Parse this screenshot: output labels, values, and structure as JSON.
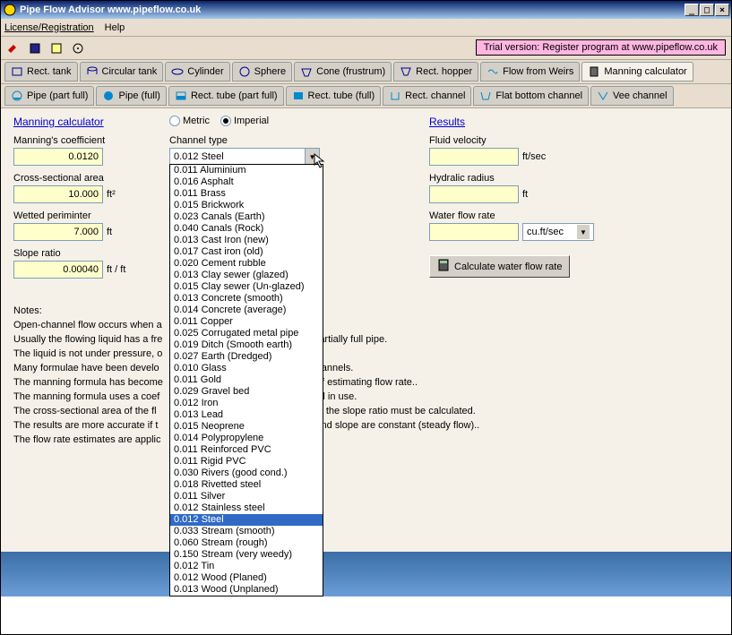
{
  "title": "Pipe Flow Advisor     www.pipeflow.co.uk",
  "menu": {
    "license": "License/Registration",
    "help": "Help"
  },
  "trial": "Trial version: Register program at www.pipeflow.co.uk",
  "tabs1": [
    {
      "label": "Rect. tank"
    },
    {
      "label": "Circular tank"
    },
    {
      "label": "Cylinder"
    },
    {
      "label": "Sphere"
    },
    {
      "label": "Cone (frustrum)"
    },
    {
      "label": "Rect. hopper"
    },
    {
      "label": "Flow from Weirs"
    },
    {
      "label": "Manning calculator"
    }
  ],
  "tabs2": [
    {
      "label": "Pipe (part full)"
    },
    {
      "label": "Pipe (full)"
    },
    {
      "label": "Rect. tube (part full)"
    },
    {
      "label": "Rect. tube (full)"
    },
    {
      "label": "Rect. channel"
    },
    {
      "label": "Flat bottom channel"
    },
    {
      "label": "Vee channel"
    }
  ],
  "manning": {
    "title": "Manning calculator",
    "coef_label": "Manning's coefficient",
    "coef_value": "0.0120",
    "area_label": "Cross-sectional area",
    "area_value": "10.000",
    "area_unit": "ft²",
    "wetted_label": "Wetted periminter",
    "wetted_value": "7.000",
    "wetted_unit": "ft",
    "slope_label": "Slope ratio",
    "slope_value": "0.00040",
    "slope_unit": "ft / ft"
  },
  "units": {
    "metric": "Metric",
    "imperial": "Imperial"
  },
  "channel": {
    "label": "Channel type",
    "selected": "0.012  Steel",
    "options": [
      "0.011  Aluminium",
      "0.016  Asphalt",
      "0.011  Brass",
      "0.015  Brickwork",
      "0.023  Canals (Earth)",
      "0.040  Canals (Rock)",
      "0.013  Cast Iron (new)",
      "0.017  Cast iron (old)",
      "0.020  Cement rubble",
      "0.013  Clay sewer (glazed)",
      "0.015  Clay sewer (Un-glazed)",
      "0.013  Concrete (smooth)",
      "0.014  Concrete (average)",
      "0.011  Copper",
      "0.025  Corrugated metal pipe",
      "0.019  Ditch (Smooth earth)",
      "0.027  Earth (Dredged)",
      "0.010  Glass",
      "0.011  Gold",
      "0.029  Gravel bed",
      "0.012  Iron",
      "0.013  Lead",
      "0.015  Neoprene",
      "0.014  Polypropylene",
      "0.011  Reinforced PVC",
      "0.011  Rigid PVC",
      "0.030  Rivers (good cond.)",
      "0.018  Rivetted steel",
      "0.011  Silver",
      "0.012  Stainless steel",
      "0.012  Steel",
      "0.033  Stream (smooth)",
      "0.060  Stream (rough)",
      "0.150  Stream (very weedy)",
      "0.012  Tin",
      "0.012  Wood (Planed)",
      "0.013  Wood (Unplaned)"
    ]
  },
  "results": {
    "title": "Results",
    "velocity_label": "Fluid velocity",
    "velocity_unit": "ft/sec",
    "radius_label": "Hydralic radius",
    "radius_unit": "ft",
    "flow_label": "Water flow rate",
    "flow_unit": "cu.ft/sec",
    "calc_btn": "Calculate water flow rate"
  },
  "notes": {
    "heading": "Notes:",
    "l1": "Open-channel flow occurs when a",
    "l2": "Usually the flowing liquid has a fre",
    "l2b": "artially full pipe.",
    "l3": "The liquid is not under pressure, o",
    "l4": "Many formulae have been develo",
    "l4b": "hannels.",
    "l5": "The manning formula has become",
    "l5b": "of estimating flow rate..",
    "l6": "The manning formula uses a coef",
    "l6b": "el in use.",
    "l7": "The cross-sectional area  of the fl",
    "l7b": "nd the slope ratio must be calculated.",
    "l8": "The results are more accurate if t",
    "l8b": "and slope are constant (steady flow)..",
    "l9": "The flow rate estimates are applic"
  }
}
